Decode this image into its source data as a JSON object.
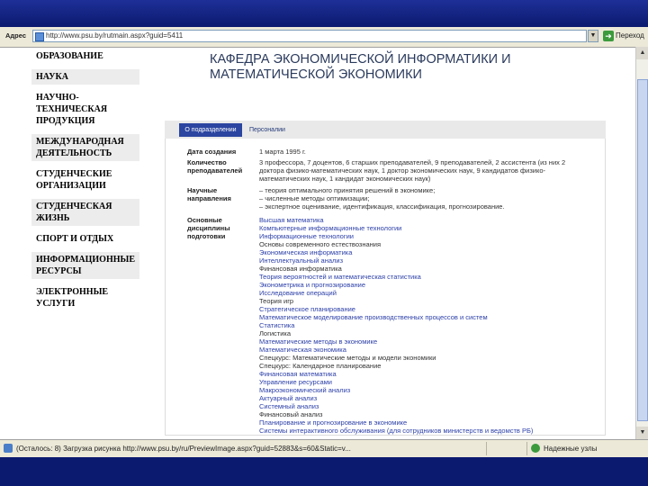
{
  "browser": {
    "address_label": "Адрес",
    "url": "http://www.psu.by/rutmain.aspx?guid=5411",
    "go_label": "Переход",
    "status_text": "(Осталось: 8) Загрузка рисунка http://www.psu.by/ru/PreviewImage.aspx?guid=52883&s=60&Static=v...",
    "zone_label": "Надежные узлы"
  },
  "sidebar": {
    "items": [
      {
        "label": "Образование",
        "shaded": false
      },
      {
        "label": "Наука",
        "shaded": true
      },
      {
        "label": "Научно-техническая продукция",
        "shaded": false
      },
      {
        "label": "Международная деятельность",
        "shaded": true
      },
      {
        "label": "Студенческие организации",
        "shaded": false
      },
      {
        "label": "Студенческая жизнь",
        "shaded": true
      },
      {
        "label": "Спорт и отдых",
        "shaded": false
      },
      {
        "label": "Информационные ресурсы",
        "shaded": true
      },
      {
        "label": "Электронные услуги",
        "shaded": false
      }
    ]
  },
  "page": {
    "title_line1": "Кафедра экономической информатики и",
    "title_line2": "математической экономики"
  },
  "tabs": [
    {
      "label": "О подразделении",
      "active": true
    },
    {
      "label": "Персоналии",
      "active": false
    }
  ],
  "details": {
    "founded_label": "Дата создания",
    "founded_value": "1 марта 1995 г.",
    "staff_label_1": "Количество",
    "staff_label_2": "преподавателей",
    "staff_line1": "3 профессора, 7 доцентов, 6 старших преподавателей, 9 преподавателей, 2 ассистента (из них 2",
    "staff_line2": "доктора физико-математических наук, 1 доктор экономических наук, 9 кандидатов физико-",
    "staff_line3": "математических наук, 1 кандидат экономических наук)",
    "research_label_1": "Научные",
    "research_label_2": "направления",
    "research_line1": "– теория оптимального принятия решений в экономике;",
    "research_line2": "– численные методы оптимизации;",
    "research_line3": "– экспертное оценивание, идентификация, классификация, прогнозирование.",
    "disciplines_label_1": "Основные",
    "disciplines_label_2": "дисциплины",
    "disciplines_label_3": "подготовки"
  },
  "disciplines": [
    {
      "label": "Высшая математика",
      "link": true
    },
    {
      "label": "Компьютерные информационные технологии",
      "link": true
    },
    {
      "label": "Информационные технологии",
      "link": true
    },
    {
      "label": "Основы современного естествознания",
      "link": false
    },
    {
      "label": "Экономическая информатика",
      "link": true
    },
    {
      "label": "Интеллектуальный анализ",
      "link": true
    },
    {
      "label": "Финансовая информатика",
      "link": false
    },
    {
      "label": "Теория вероятностей и математическая статистика",
      "link": true
    },
    {
      "label": "Эконометрика и прогнозирование",
      "link": true
    },
    {
      "label": "Исследование операций",
      "link": true
    },
    {
      "label": "Теория игр",
      "link": false
    },
    {
      "label": "Стратегическое планирование",
      "link": true
    },
    {
      "label": "Математическое моделирование производственных процессов и систем",
      "link": true
    },
    {
      "label": "Статистика",
      "link": true
    },
    {
      "label": "Логистика",
      "link": false
    },
    {
      "label": "Математические методы в экономике",
      "link": true
    },
    {
      "label": "Математическая экономика",
      "link": true
    },
    {
      "label": "Спецкурс: Математические методы и модели экономики",
      "link": false
    },
    {
      "label": "Спецкурс: Календарное планирование",
      "link": false
    },
    {
      "label": "Финансовая математика",
      "link": true
    },
    {
      "label": "Управление ресурсами",
      "link": true
    },
    {
      "label": "Макроэкономический анализ",
      "link": true
    },
    {
      "label": "Актуарный анализ",
      "link": true
    },
    {
      "label": "Системный анализ",
      "link": true
    },
    {
      "label": "Финансовый анализ",
      "link": false
    },
    {
      "label": "Планирование и прогнозирование в экономике",
      "link": true
    },
    {
      "label": "Системы интерактивного обслуживания (для сотрудников министерств и ведомств РБ)",
      "link": true
    }
  ]
}
